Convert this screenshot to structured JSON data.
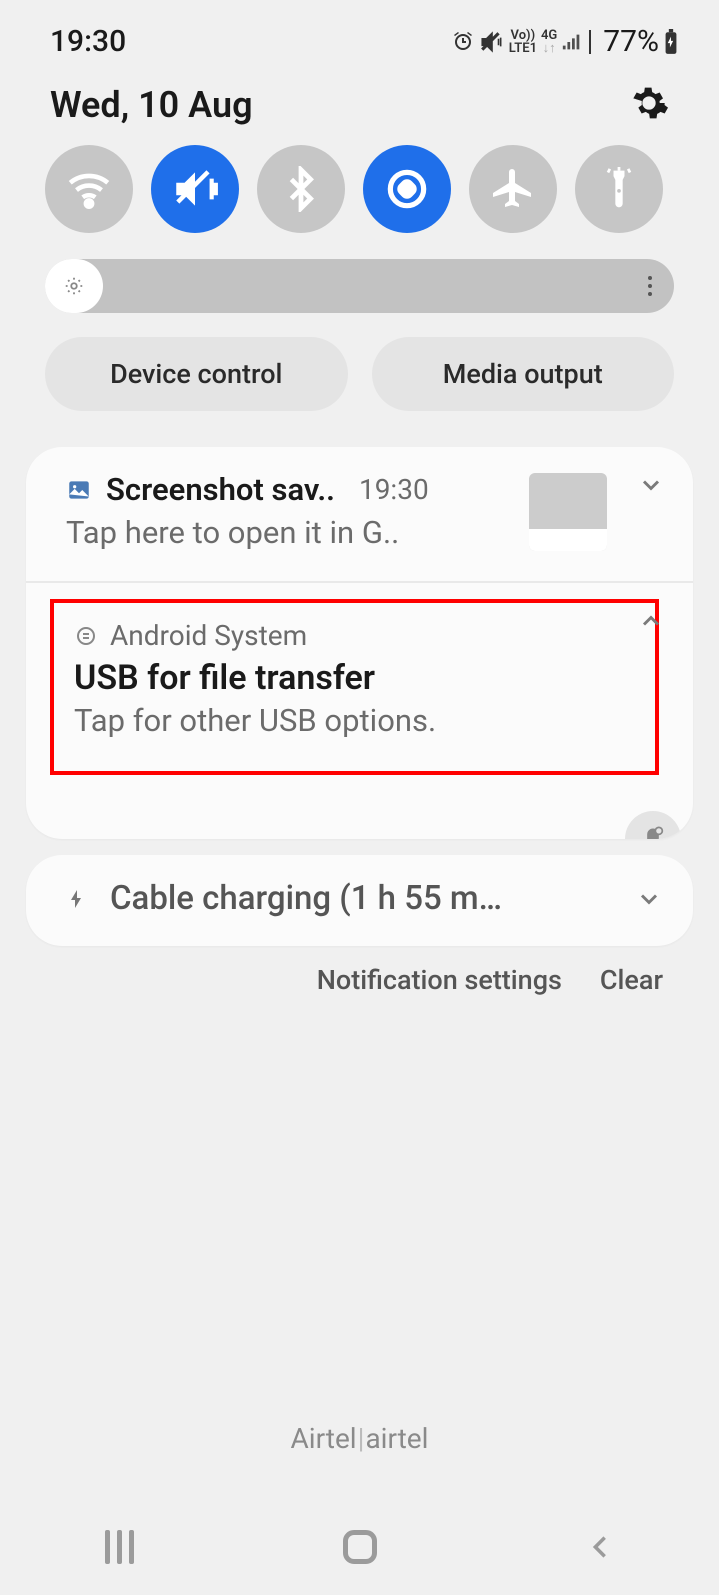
{
  "status_bar": {
    "time": "19:30",
    "vo": "Vo))",
    "lte": "LTE1",
    "net": "4G",
    "battery": "77%"
  },
  "header": {
    "date": "Wed, 10 Aug"
  },
  "chips": {
    "device_control": "Device control",
    "media_output": "Media output"
  },
  "notifications": [
    {
      "app": "Screenshot sav..",
      "time": "19:30",
      "body": "Tap here to open it in G.."
    },
    {
      "app": "Android System",
      "title": "USB for file transfer",
      "body": "Tap for other USB options."
    }
  ],
  "charging": {
    "text": "Cable charging (1 h 55 m…"
  },
  "footer": {
    "settings": "Notification settings",
    "clear": "Clear"
  },
  "carrier": {
    "a": "Airtel",
    "b": "airtel"
  }
}
